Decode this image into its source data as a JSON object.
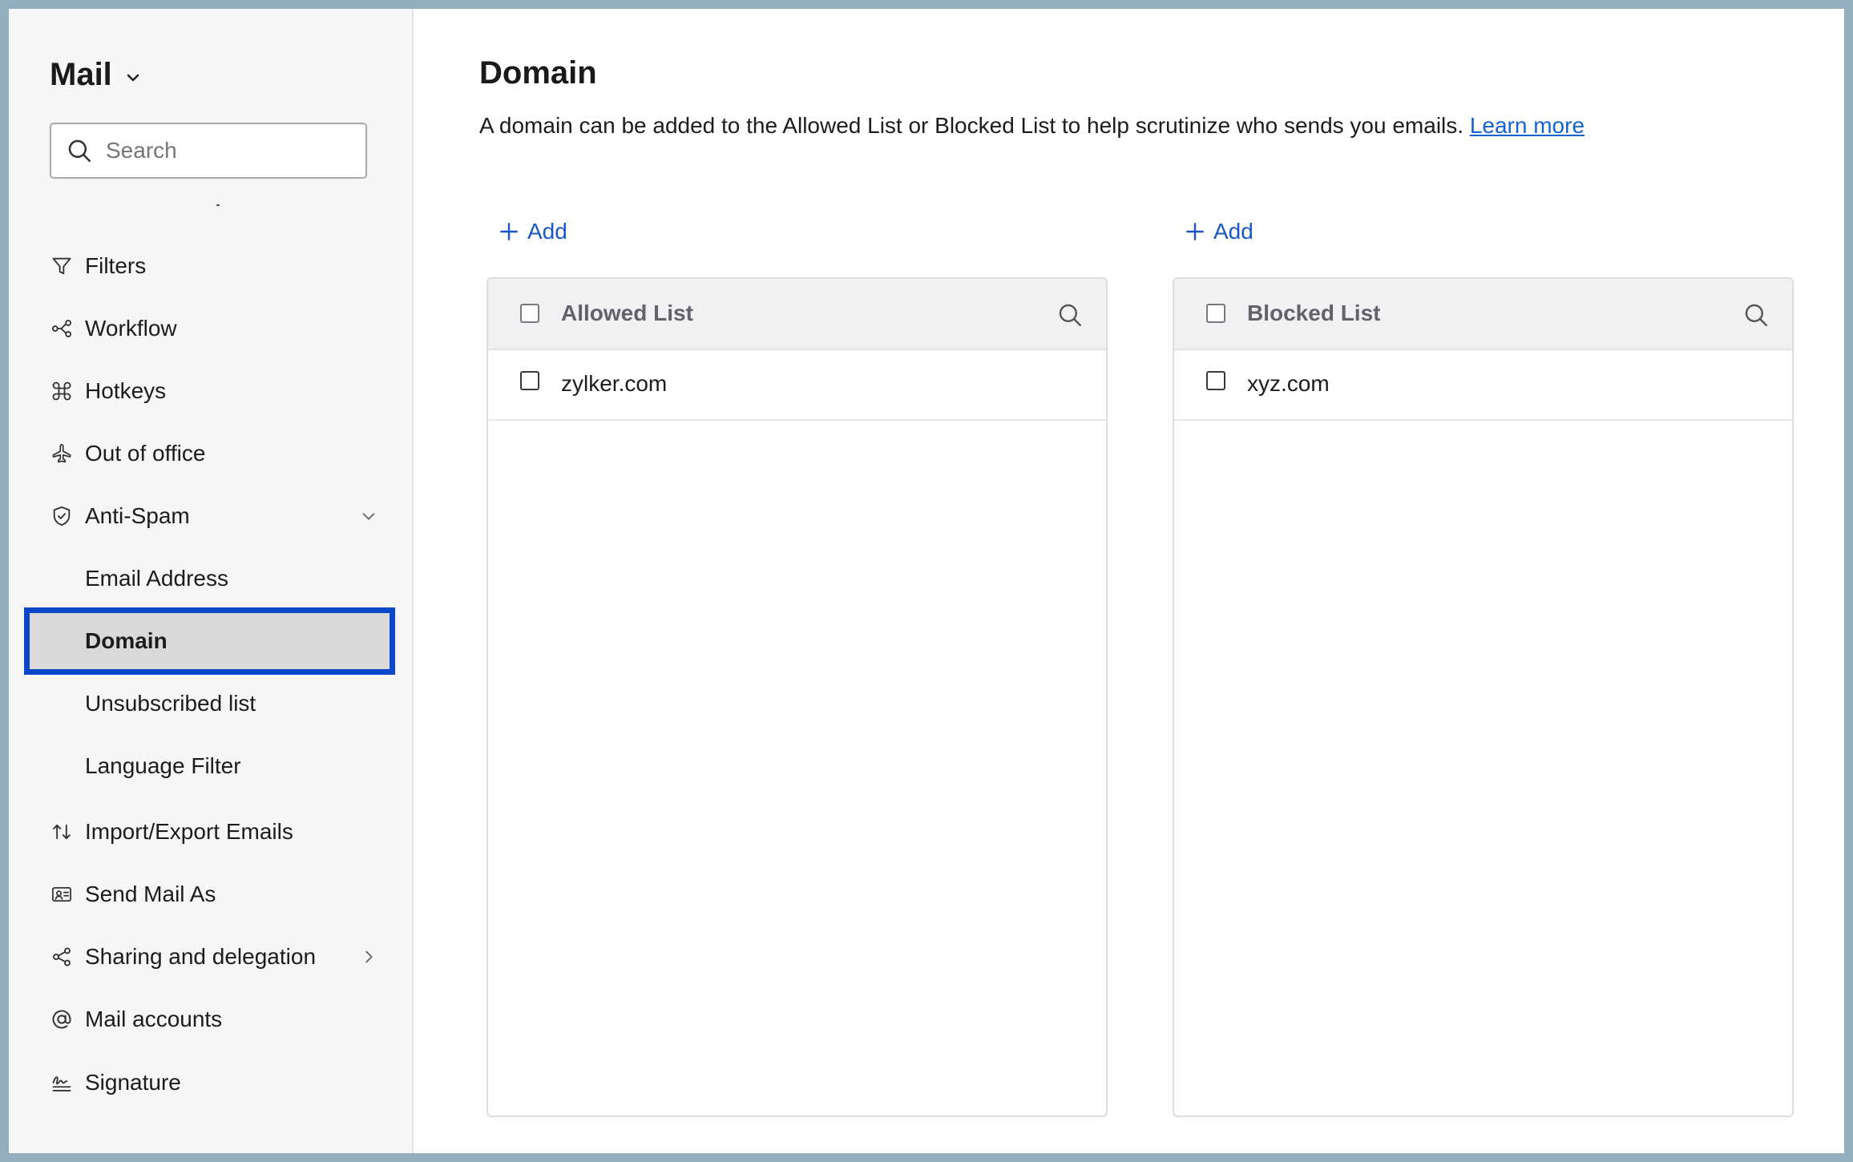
{
  "sidebar": {
    "app_title": "Mail",
    "search_placeholder": "Search",
    "items": [
      {
        "label": "Filters",
        "icon": "filter-icon"
      },
      {
        "label": "Workflow",
        "icon": "workflow-icon"
      },
      {
        "label": "Hotkeys",
        "icon": "command-key-icon"
      },
      {
        "label": "Out of office",
        "icon": "airplane-icon"
      },
      {
        "label": "Anti-Spam",
        "icon": "shield-icon",
        "expanded": true
      },
      {
        "label": "Email Address"
      },
      {
        "label": "Domain",
        "selected": true
      },
      {
        "label": "Unsubscribed list"
      },
      {
        "label": "Language Filter"
      },
      {
        "label": "Import/Export Emails",
        "icon": "import-export-icon"
      },
      {
        "label": "Send Mail As",
        "icon": "contact-card-icon"
      },
      {
        "label": "Sharing and delegation",
        "icon": "share-icon"
      },
      {
        "label": "Mail accounts",
        "icon": "at-sign-icon"
      },
      {
        "label": "Signature",
        "icon": "signature-icon"
      }
    ]
  },
  "main": {
    "title": "Domain",
    "description": "A domain can be added to the Allowed List or Blocked List to help scrutinize who sends you emails.",
    "learn_more": "Learn more",
    "add_label": "Add",
    "allowed": {
      "title": "Allowed List",
      "rows": [
        "zylker.com"
      ]
    },
    "blocked": {
      "title": "Blocked List",
      "rows": [
        "xyz.com"
      ]
    }
  },
  "colors": {
    "selection_border": "#0a46c8",
    "link": "#1463d6",
    "add_button": "#1a56c7",
    "sidebar_bg": "#f6f6f7"
  }
}
